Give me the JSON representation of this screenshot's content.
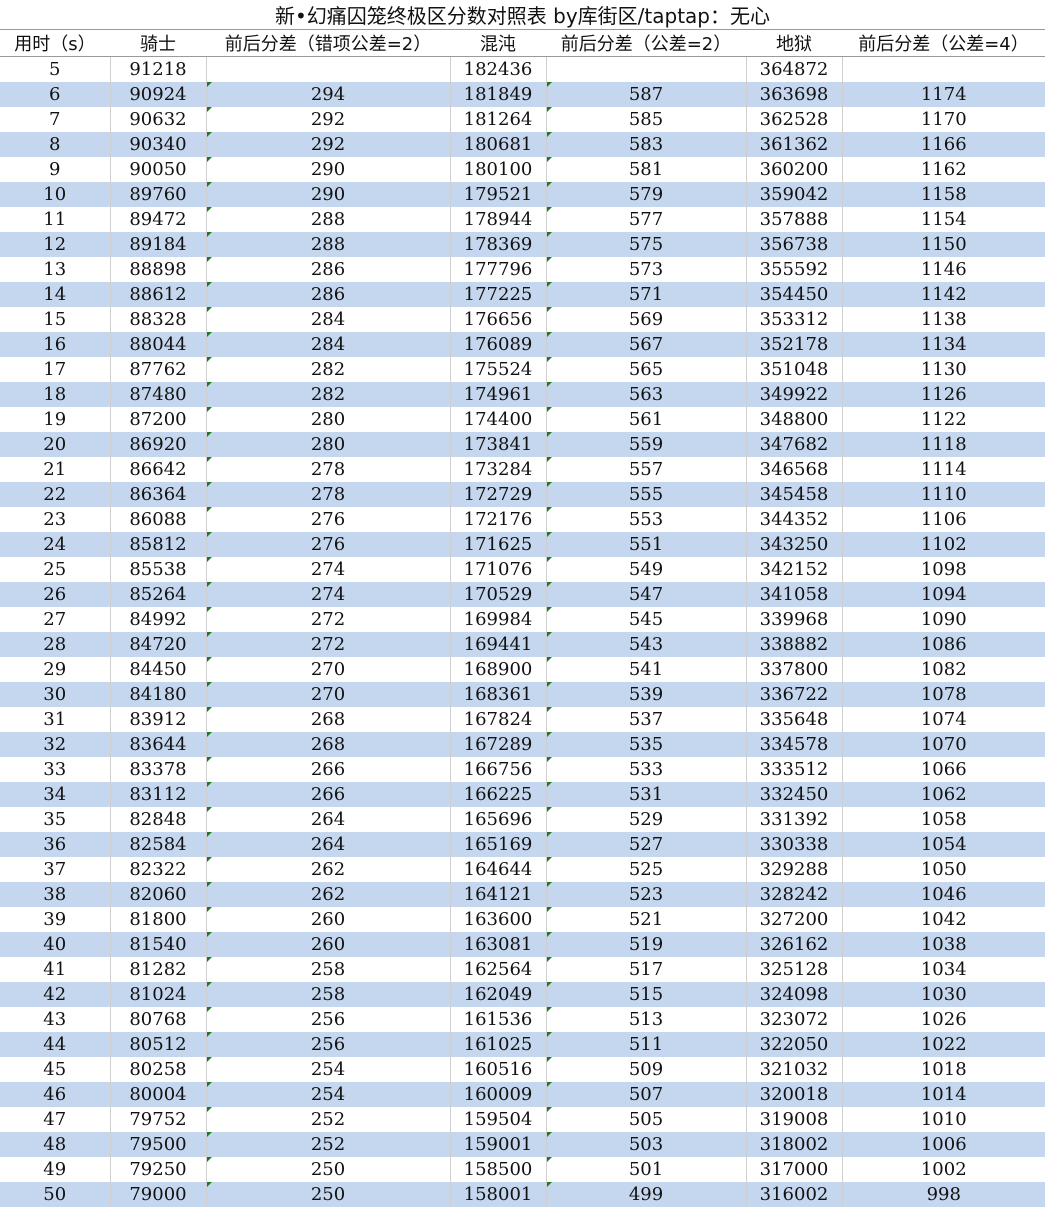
{
  "title": "新•幻痛囚笼终极区分数对照表 by库街区/taptap：无心",
  "headers": [
    "用时（s）",
    "骑士",
    "前后分差（错项公差=2）",
    "混沌",
    "前后分差（公差=2）",
    "地狱",
    "前后分差（公差=4）"
  ],
  "rows": [
    [
      "5",
      "91218",
      "",
      "182436",
      "",
      "364872",
      ""
    ],
    [
      "6",
      "90924",
      "294",
      "181849",
      "587",
      "363698",
      "1174"
    ],
    [
      "7",
      "90632",
      "292",
      "181264",
      "585",
      "362528",
      "1170"
    ],
    [
      "8",
      "90340",
      "292",
      "180681",
      "583",
      "361362",
      "1166"
    ],
    [
      "9",
      "90050",
      "290",
      "180100",
      "581",
      "360200",
      "1162"
    ],
    [
      "10",
      "89760",
      "290",
      "179521",
      "579",
      "359042",
      "1158"
    ],
    [
      "11",
      "89472",
      "288",
      "178944",
      "577",
      "357888",
      "1154"
    ],
    [
      "12",
      "89184",
      "288",
      "178369",
      "575",
      "356738",
      "1150"
    ],
    [
      "13",
      "88898",
      "286",
      "177796",
      "573",
      "355592",
      "1146"
    ],
    [
      "14",
      "88612",
      "286",
      "177225",
      "571",
      "354450",
      "1142"
    ],
    [
      "15",
      "88328",
      "284",
      "176656",
      "569",
      "353312",
      "1138"
    ],
    [
      "16",
      "88044",
      "284",
      "176089",
      "567",
      "352178",
      "1134"
    ],
    [
      "17",
      "87762",
      "282",
      "175524",
      "565",
      "351048",
      "1130"
    ],
    [
      "18",
      "87480",
      "282",
      "174961",
      "563",
      "349922",
      "1126"
    ],
    [
      "19",
      "87200",
      "280",
      "174400",
      "561",
      "348800",
      "1122"
    ],
    [
      "20",
      "86920",
      "280",
      "173841",
      "559",
      "347682",
      "1118"
    ],
    [
      "21",
      "86642",
      "278",
      "173284",
      "557",
      "346568",
      "1114"
    ],
    [
      "22",
      "86364",
      "278",
      "172729",
      "555",
      "345458",
      "1110"
    ],
    [
      "23",
      "86088",
      "276",
      "172176",
      "553",
      "344352",
      "1106"
    ],
    [
      "24",
      "85812",
      "276",
      "171625",
      "551",
      "343250",
      "1102"
    ],
    [
      "25",
      "85538",
      "274",
      "171076",
      "549",
      "342152",
      "1098"
    ],
    [
      "26",
      "85264",
      "274",
      "170529",
      "547",
      "341058",
      "1094"
    ],
    [
      "27",
      "84992",
      "272",
      "169984",
      "545",
      "339968",
      "1090"
    ],
    [
      "28",
      "84720",
      "272",
      "169441",
      "543",
      "338882",
      "1086"
    ],
    [
      "29",
      "84450",
      "270",
      "168900",
      "541",
      "337800",
      "1082"
    ],
    [
      "30",
      "84180",
      "270",
      "168361",
      "539",
      "336722",
      "1078"
    ],
    [
      "31",
      "83912",
      "268",
      "167824",
      "537",
      "335648",
      "1074"
    ],
    [
      "32",
      "83644",
      "268",
      "167289",
      "535",
      "334578",
      "1070"
    ],
    [
      "33",
      "83378",
      "266",
      "166756",
      "533",
      "333512",
      "1066"
    ],
    [
      "34",
      "83112",
      "266",
      "166225",
      "531",
      "332450",
      "1062"
    ],
    [
      "35",
      "82848",
      "264",
      "165696",
      "529",
      "331392",
      "1058"
    ],
    [
      "36",
      "82584",
      "264",
      "165169",
      "527",
      "330338",
      "1054"
    ],
    [
      "37",
      "82322",
      "262",
      "164644",
      "525",
      "329288",
      "1050"
    ],
    [
      "38",
      "82060",
      "262",
      "164121",
      "523",
      "328242",
      "1046"
    ],
    [
      "39",
      "81800",
      "260",
      "163600",
      "521",
      "327200",
      "1042"
    ],
    [
      "40",
      "81540",
      "260",
      "163081",
      "519",
      "326162",
      "1038"
    ],
    [
      "41",
      "81282",
      "258",
      "162564",
      "517",
      "325128",
      "1034"
    ],
    [
      "42",
      "81024",
      "258",
      "162049",
      "515",
      "324098",
      "1030"
    ],
    [
      "43",
      "80768",
      "256",
      "161536",
      "513",
      "323072",
      "1026"
    ],
    [
      "44",
      "80512",
      "256",
      "161025",
      "511",
      "322050",
      "1022"
    ],
    [
      "45",
      "80258",
      "254",
      "160516",
      "509",
      "321032",
      "1018"
    ],
    [
      "46",
      "80004",
      "254",
      "160009",
      "507",
      "320018",
      "1014"
    ],
    [
      "47",
      "79752",
      "252",
      "159504",
      "505",
      "319008",
      "1010"
    ],
    [
      "48",
      "79500",
      "252",
      "159001",
      "503",
      "318002",
      "1006"
    ],
    [
      "49",
      "79250",
      "250",
      "158500",
      "501",
      "317000",
      "1002"
    ],
    [
      "50",
      "79000",
      "250",
      "158001",
      "499",
      "316002",
      "998"
    ]
  ],
  "colors": {
    "alt_row": "#c5d7ee",
    "marker": "#1f7a1f"
  }
}
